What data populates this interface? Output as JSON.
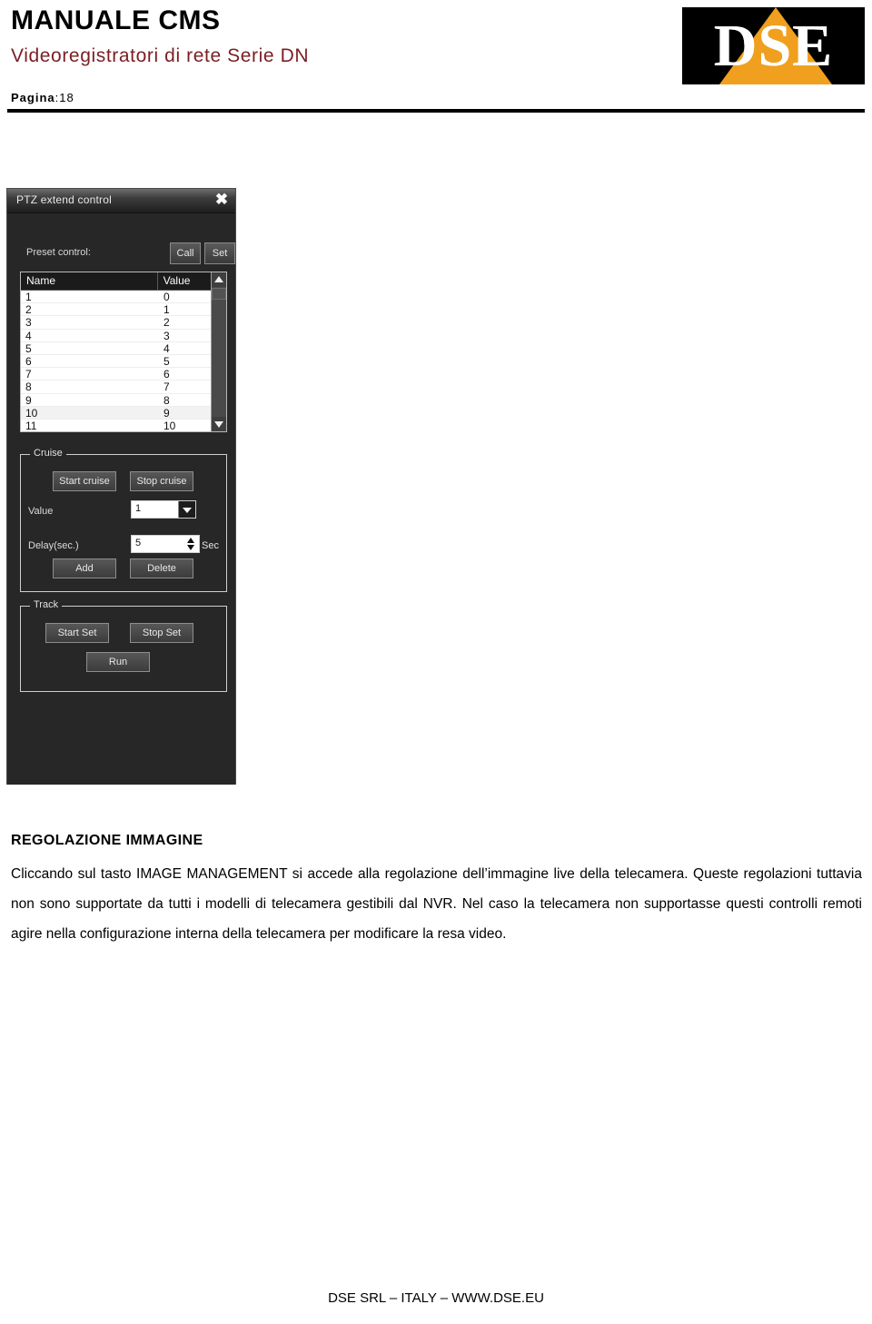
{
  "header": {
    "manual_title": "MANUALE CMS",
    "manual_subtitle": "Videoregistratori di rete Serie DN",
    "page_label_bold": "Pagina",
    "page_label_value": ":18",
    "logo_text": "DSE",
    "logo_bg_color": "#000000",
    "logo_accent_color": "#F0A01E",
    "subtitle_color": "#7B1E22"
  },
  "ptz_panel": {
    "title": "PTZ extend control",
    "close_icon": "close-icon",
    "preset": {
      "label": "Preset control:",
      "call_button": "Call",
      "set_button": "Set",
      "columns": [
        "Name",
        "Value"
      ],
      "rows": [
        {
          "name": "1",
          "value": "0"
        },
        {
          "name": "2",
          "value": "1"
        },
        {
          "name": "3",
          "value": "2"
        },
        {
          "name": "4",
          "value": "3"
        },
        {
          "name": "5",
          "value": "4"
        },
        {
          "name": "6",
          "value": "5"
        },
        {
          "name": "7",
          "value": "6"
        },
        {
          "name": "8",
          "value": "7"
        },
        {
          "name": "9",
          "value": "8"
        },
        {
          "name": "10",
          "value": "9"
        },
        {
          "name": "11",
          "value": "10"
        }
      ]
    },
    "cruise": {
      "legend": "Cruise",
      "start_button": "Start cruise",
      "stop_button": "Stop cruise",
      "value_label": "Value",
      "value_selected": "1",
      "delay_label": "Delay(sec.)",
      "delay_value": "5",
      "delay_unit": "Sec",
      "add_button": "Add",
      "delete_button": "Delete"
    },
    "track": {
      "legend": "Track",
      "start_set_button": "Start Set",
      "stop_set_button": "Stop Set",
      "run_button": "Run"
    }
  },
  "content": {
    "section_heading": "REGOLAZIONE IMMAGINE",
    "paragraph": "Cliccando sul tasto IMAGE MANAGEMENT si accede alla regolazione dell’immagine live della telecamera. Queste regolazioni tuttavia non sono supportate da tutti i modelli di telecamera gestibili dal NVR. Nel caso la telecamera non supportasse questi controlli remoti agire nella configurazione interna della telecamera per modificare la resa video."
  },
  "footer": {
    "text": "DSE SRL – ITALY – WWW.DSE.EU"
  }
}
